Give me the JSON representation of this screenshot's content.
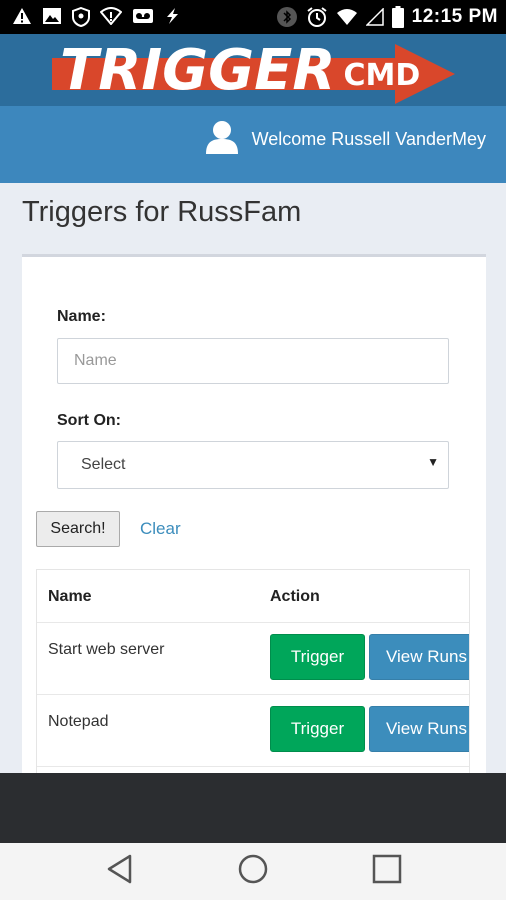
{
  "status_bar": {
    "time": "12:15 PM",
    "left_icons": [
      "warning-icon",
      "image-icon",
      "shield-icon",
      "wifi-alert-icon",
      "voicemail-icon",
      "flash-icon"
    ],
    "right_icons": [
      "bluetooth-icon",
      "alarm-icon",
      "wifi-icon",
      "signal-icon",
      "battery-icon"
    ]
  },
  "header": {
    "logo_main": "TRIGGER",
    "logo_sub": "CMD",
    "welcome": "Welcome Russell VanderMey",
    "user_icon": "user-icon",
    "colors": {
      "band": "#2c6d9c",
      "bar": "#3d87bd",
      "arrow": "#d9472b"
    }
  },
  "page": {
    "title": "Triggers for RussFam"
  },
  "form": {
    "name_label": "Name:",
    "name_placeholder": "Name",
    "name_value": "",
    "sort_label": "Sort On:",
    "sort_value": "Select",
    "search_button": "Search!",
    "clear_link": "Clear"
  },
  "table": {
    "headers": {
      "name": "Name",
      "action": "Action"
    },
    "rows": [
      {
        "name": "Start web server",
        "trigger": "Trigger",
        "view_runs": "View Runs"
      },
      {
        "name": "Notepad",
        "trigger": "Trigger",
        "view_runs": "View Runs"
      }
    ],
    "colors": {
      "trigger": "#00a65a",
      "view_runs": "#3c8dbc"
    }
  },
  "nav_bar": {
    "icons": [
      "back-icon",
      "home-icon",
      "recents-icon"
    ]
  }
}
